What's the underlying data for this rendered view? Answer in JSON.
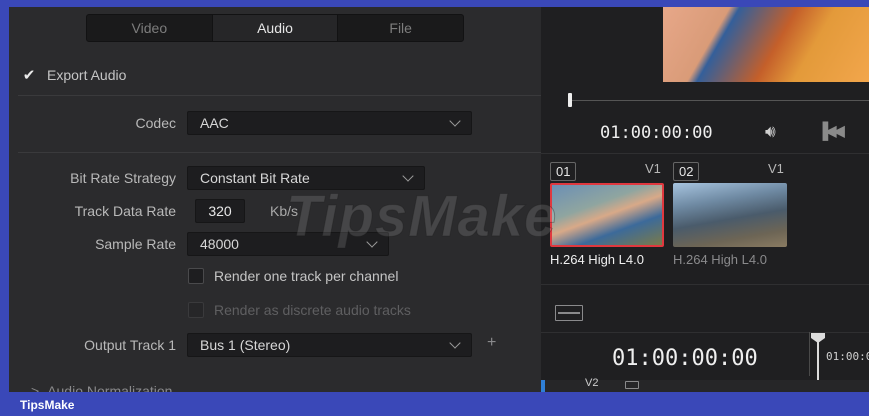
{
  "tabs": [
    {
      "label": "Video",
      "active": false
    },
    {
      "label": "Audio",
      "active": true
    },
    {
      "label": "File",
      "active": false
    }
  ],
  "export_audio": {
    "label": "Export Audio",
    "checked": true
  },
  "codec": {
    "label": "Codec",
    "value": "AAC"
  },
  "bit_rate_strategy": {
    "label": "Bit Rate Strategy",
    "value": "Constant Bit Rate"
  },
  "track_data_rate": {
    "label": "Track Data Rate",
    "value": "320",
    "unit": "Kb/s"
  },
  "sample_rate": {
    "label": "Sample Rate",
    "value": "48000"
  },
  "render_one_track": {
    "label": "Render one track per channel",
    "checked": false
  },
  "render_discrete": {
    "label": "Render as discrete audio tracks",
    "checked": false,
    "disabled": true
  },
  "output_track": {
    "label": "Output Track 1",
    "value": "Bus 1 (Stereo)",
    "add_symbol": "+"
  },
  "audio_normalization": {
    "label": "Audio Normalization",
    "chevron": ">"
  },
  "viewer": {
    "timecode": "01:00:00:00"
  },
  "clips": [
    {
      "number": "01",
      "track": "V1",
      "codec": "H.264 High L4.0",
      "selected": true
    },
    {
      "number": "02",
      "track": "V1",
      "codec": "H.264 High L4.0",
      "selected": false
    }
  ],
  "timeline": {
    "timecode": "01:00:00:00",
    "ruler_tc": "01:00:0",
    "track_label": "V2"
  },
  "watermark": "TipsMake",
  "footer": {
    "brand": "TipsMake"
  },
  "colors": {
    "frame": "#3a48b8",
    "selection": "#e0383f",
    "accent_blue": "#2f7fd6"
  }
}
